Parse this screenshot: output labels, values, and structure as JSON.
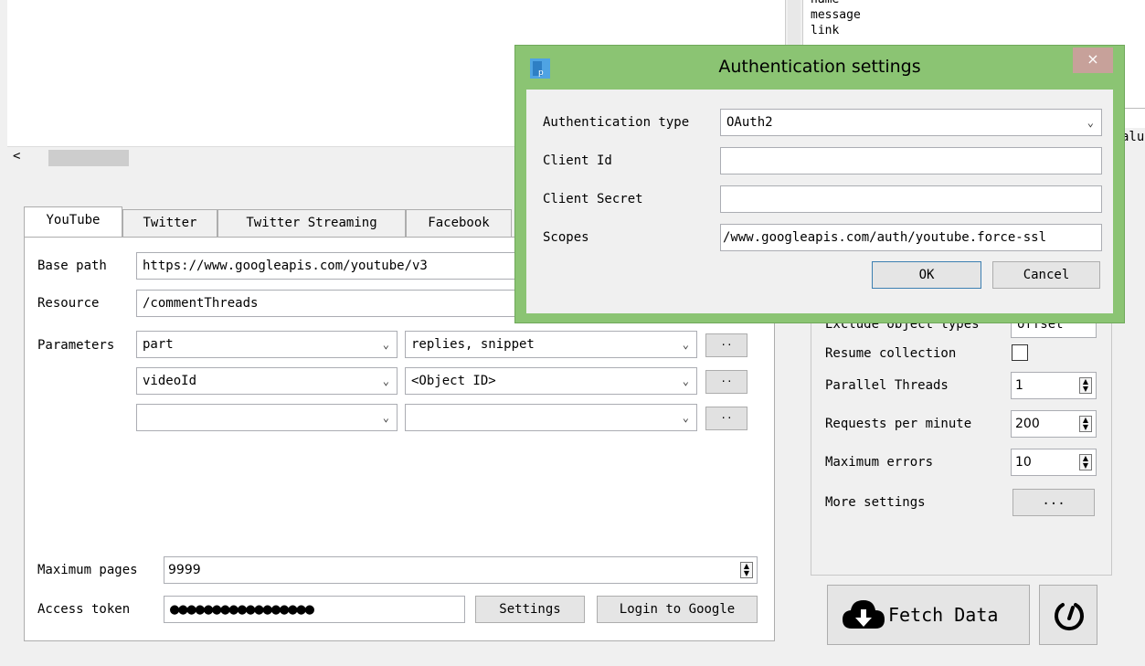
{
  "top_right_list": [
    "name",
    "message",
    "link"
  ],
  "top_right_extra": "alu",
  "tabs": [
    {
      "label": "YouTube",
      "active": true
    },
    {
      "label": "Twitter",
      "active": false
    },
    {
      "label": "Twitter Streaming",
      "active": false
    },
    {
      "label": "Facebook",
      "active": false
    }
  ],
  "youtube": {
    "base_path_label": "Base path",
    "base_path": "https://www.googleapis.com/youtube/v3",
    "resource_label": "Resource",
    "resource": "/commentThreads",
    "parameters_label": "Parameters",
    "params": [
      {
        "name": "part",
        "value": "replies, snippet"
      },
      {
        "name": "videoId",
        "value": "<Object ID>"
      },
      {
        "name": "",
        "value": ""
      }
    ],
    "more_button": "..",
    "max_pages_label": "Maximum pages",
    "max_pages": "9999",
    "access_token_label": "Access token",
    "access_token_mask": "●●●●●●●●●●●●●●●●●",
    "settings_button": "Settings",
    "login_button": "Login to Google"
  },
  "settings_panel": {
    "exclude_label": "Exclude object types",
    "exclude_value": "offset",
    "resume_label": "Resume collection",
    "parallel_label": "Parallel Threads",
    "parallel_value": "1",
    "rpm_label": "Requests per minute",
    "rpm_value": "200",
    "max_errors_label": "Maximum errors",
    "max_errors_value": "10",
    "more_settings_label": "More settings",
    "more_settings_button": "..."
  },
  "fetch_button": "Fetch Data",
  "dialog": {
    "title": "Authentication settings",
    "close": "×",
    "auth_type_label": "Authentication type",
    "auth_type": "OAuth2",
    "client_id_label": "Client Id",
    "client_id": "",
    "client_secret_label": "Client Secret",
    "client_secret": "",
    "scopes_label": "Scopes",
    "scopes": "/www.googleapis.com/auth/youtube.force-ssl",
    "ok": "OK",
    "cancel": "Cancel"
  },
  "colors": {
    "dialog_border": "#8bc473",
    "close_bg": "#c7a19a",
    "ok_border": "#3c7fb1"
  }
}
